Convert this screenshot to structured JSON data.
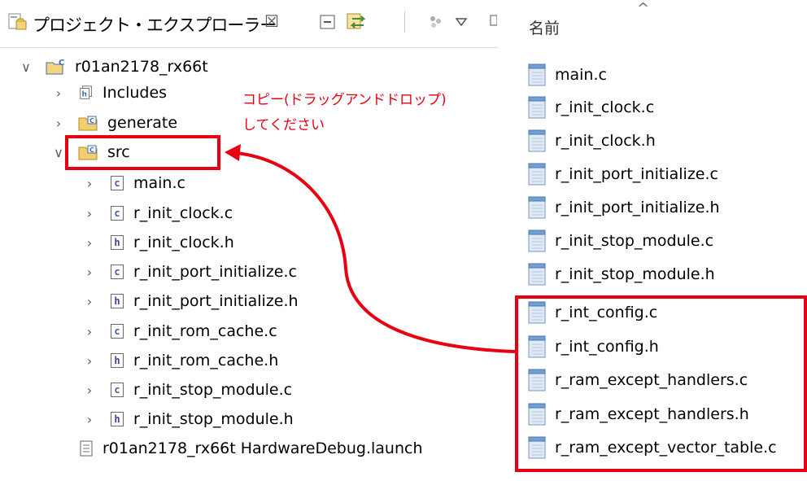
{
  "view": {
    "title": "プロジェクト・エクスプローラー",
    "close_glyph": "☒"
  },
  "tree": {
    "project": "r01an2178_rx66t",
    "includes": "Includes",
    "generate": "generate",
    "src": "src",
    "src_files": [
      {
        "name": "main.c",
        "type": "c"
      },
      {
        "name": "r_init_clock.c",
        "type": "c"
      },
      {
        "name": "r_init_clock.h",
        "type": "h"
      },
      {
        "name": "r_init_port_initialize.c",
        "type": "c"
      },
      {
        "name": "r_init_port_initialize.h",
        "type": "h"
      },
      {
        "name": "r_init_rom_cache.c",
        "type": "c"
      },
      {
        "name": "r_init_rom_cache.h",
        "type": "h"
      },
      {
        "name": "r_init_stop_module.c",
        "type": "c"
      },
      {
        "name": "r_init_stop_module.h",
        "type": "h"
      }
    ],
    "launch": "r01an2178_rx66t HardwareDebug.launch"
  },
  "callout": {
    "line1": "コピー(ドラッグアンドドロップ)",
    "line2": "してください"
  },
  "explorer": {
    "column_header": "名前",
    "files": [
      "main.c",
      "r_init_clock.c",
      "r_init_clock.h",
      "r_init_port_initialize.c",
      "r_init_port_initialize.h",
      "r_init_stop_module.c",
      "r_init_stop_module.h",
      "r_int_config.c",
      "r_int_config.h",
      "r_ram_except_handlers.c",
      "r_ram_except_handlers.h",
      "r_ram_except_vector_table.c"
    ]
  },
  "colors": {
    "annotation_red": "#e60012"
  }
}
